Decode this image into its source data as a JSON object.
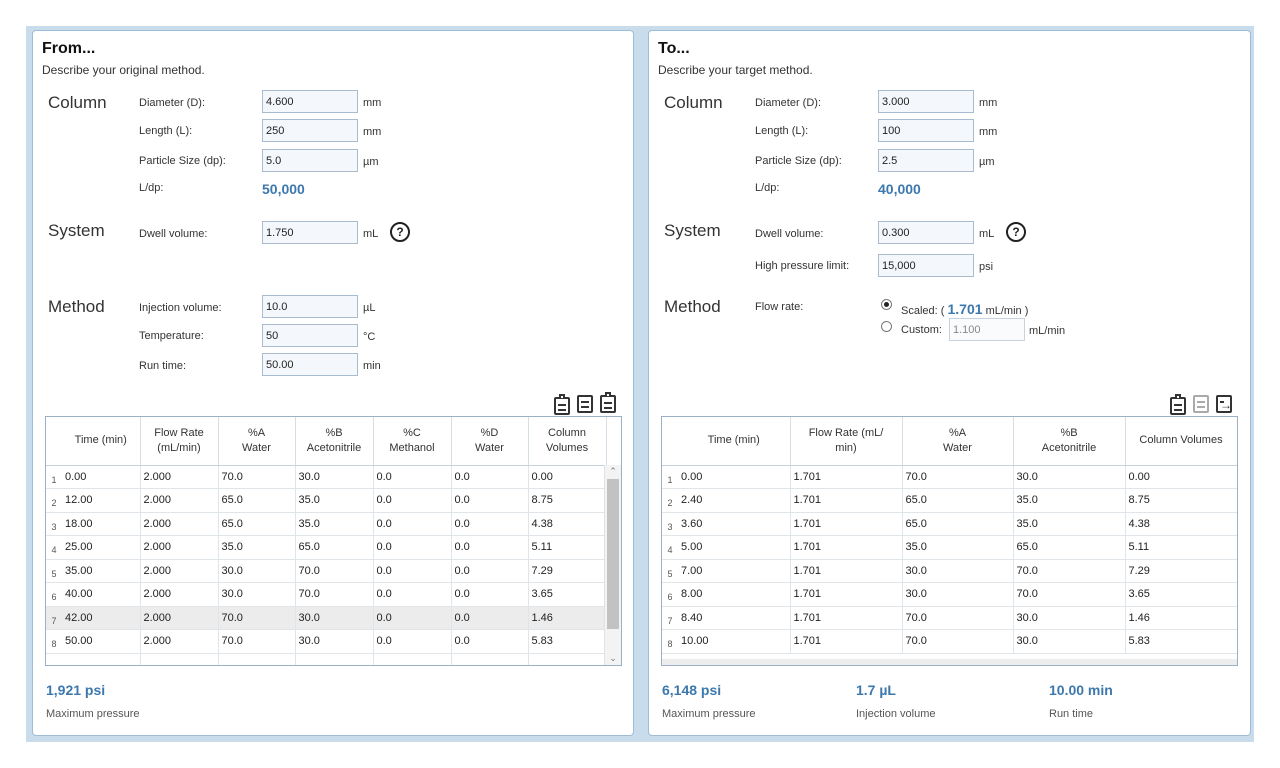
{
  "from": {
    "title": "From...",
    "subtitle": "Describe your original method.",
    "column": {
      "heading": "Column",
      "diameter_label": "Diameter (D):",
      "diameter": "4.600",
      "diameter_unit": "mm",
      "length_label": "Length (L):",
      "length": "250",
      "length_unit": "mm",
      "particle_label": "Particle Size (dp):",
      "particle": "5.0",
      "particle_unit": "µm",
      "ldp_label": "L/dp:",
      "ldp": "50,000"
    },
    "system": {
      "heading": "System",
      "dwell_label": "Dwell volume:",
      "dwell": "1.750",
      "dwell_unit": "mL",
      "help": "?"
    },
    "method": {
      "heading": "Method",
      "injection_label": "Injection volume:",
      "injection": "10.0",
      "injection_unit": "µL",
      "temp_label": "Temperature:",
      "temp": "50",
      "temp_unit": "°C",
      "runtime_label": "Run time:",
      "runtime": "50.00",
      "runtime_unit": "min"
    },
    "table": {
      "headers": [
        {
          "l1": "Time (min)",
          "l2": ""
        },
        {
          "l1": "Flow Rate",
          "l2": "(mL/min)"
        },
        {
          "l1": "%A",
          "l2": "Water"
        },
        {
          "l1": "%B",
          "l2": "Acetonitrile"
        },
        {
          "l1": "%C",
          "l2": "Methanol"
        },
        {
          "l1": "%D",
          "l2": "Water"
        },
        {
          "l1": "Column",
          "l2": "Volumes"
        }
      ],
      "rows": [
        {
          "n": "1",
          "cells": [
            "0.00",
            "2.000",
            "70.0",
            "30.0",
            "0.0",
            "0.0",
            "0.00"
          ]
        },
        {
          "n": "2",
          "cells": [
            "12.00",
            "2.000",
            "65.0",
            "35.0",
            "0.0",
            "0.0",
            "8.75"
          ]
        },
        {
          "n": "3",
          "cells": [
            "18.00",
            "2.000",
            "65.0",
            "35.0",
            "0.0",
            "0.0",
            "4.38"
          ]
        },
        {
          "n": "4",
          "cells": [
            "25.00",
            "2.000",
            "35.0",
            "65.0",
            "0.0",
            "0.0",
            "5.11"
          ]
        },
        {
          "n": "5",
          "cells": [
            "35.00",
            "2.000",
            "30.0",
            "70.0",
            "0.0",
            "0.0",
            "7.29"
          ]
        },
        {
          "n": "6",
          "cells": [
            "40.00",
            "2.000",
            "30.0",
            "70.0",
            "0.0",
            "0.0",
            "3.65"
          ]
        },
        {
          "n": "7",
          "cells": [
            "42.00",
            "2.000",
            "70.0",
            "30.0",
            "0.0",
            "0.0",
            "1.46"
          ]
        },
        {
          "n": "8",
          "cells": [
            "50.00",
            "2.000",
            "70.0",
            "30.0",
            "0.0",
            "0.0",
            "5.83"
          ]
        }
      ],
      "selected_row": "7"
    },
    "stats": {
      "pressure": "1,921 psi",
      "pressure_label": "Maximum pressure"
    }
  },
  "to": {
    "title": "To...",
    "subtitle": "Describe your target method.",
    "column": {
      "heading": "Column",
      "diameter_label": "Diameter (D):",
      "diameter": "3.000",
      "diameter_unit": "mm",
      "length_label": "Length (L):",
      "length": "100",
      "length_unit": "mm",
      "particle_label": "Particle Size (dp):",
      "particle": "2.5",
      "particle_unit": "µm",
      "ldp_label": "L/dp:",
      "ldp": "40,000"
    },
    "system": {
      "heading": "System",
      "dwell_label": "Dwell volume:",
      "dwell": "0.300",
      "dwell_unit": "mL",
      "help": "?",
      "hpl_label": "High pressure limit:",
      "hpl": "15,000",
      "hpl_unit": "psi"
    },
    "method": {
      "heading": "Method",
      "flow_label": "Flow rate:",
      "scaled_pre": "Scaled: (",
      "scaled_value": "1.701",
      "scaled_post": "mL/min )",
      "custom_label": "Custom:",
      "custom_value": "1.100",
      "custom_unit": "mL/min"
    },
    "table": {
      "headers": [
        {
          "l1": "Time (min)",
          "l2": ""
        },
        {
          "l1": "Flow Rate (mL/",
          "l2": "min)"
        },
        {
          "l1": "%A",
          "l2": "Water"
        },
        {
          "l1": "%B",
          "l2": "Acetonitrile"
        },
        {
          "l1": "Column Volumes",
          "l2": ""
        }
      ],
      "rows": [
        {
          "n": "1",
          "cells": [
            "0.00",
            "1.701",
            "70.0",
            "30.0",
            "0.00"
          ]
        },
        {
          "n": "2",
          "cells": [
            "2.40",
            "1.701",
            "65.0",
            "35.0",
            "8.75"
          ]
        },
        {
          "n": "3",
          "cells": [
            "3.60",
            "1.701",
            "65.0",
            "35.0",
            "4.38"
          ]
        },
        {
          "n": "4",
          "cells": [
            "5.00",
            "1.701",
            "35.0",
            "65.0",
            "5.11"
          ]
        },
        {
          "n": "5",
          "cells": [
            "7.00",
            "1.701",
            "30.0",
            "70.0",
            "7.29"
          ]
        },
        {
          "n": "6",
          "cells": [
            "8.00",
            "1.701",
            "30.0",
            "70.0",
            "3.65"
          ]
        },
        {
          "n": "7",
          "cells": [
            "8.40",
            "1.701",
            "70.0",
            "30.0",
            "1.46"
          ]
        },
        {
          "n": "8",
          "cells": [
            "10.00",
            "1.701",
            "70.0",
            "30.0",
            "5.83"
          ]
        }
      ]
    },
    "stats": {
      "pressure": "6,148 psi",
      "pressure_label": "Maximum pressure",
      "injection": "1.7 µL",
      "injection_label": "Injection volume",
      "runtime": "10.00 min",
      "runtime_label": "Run time"
    }
  }
}
